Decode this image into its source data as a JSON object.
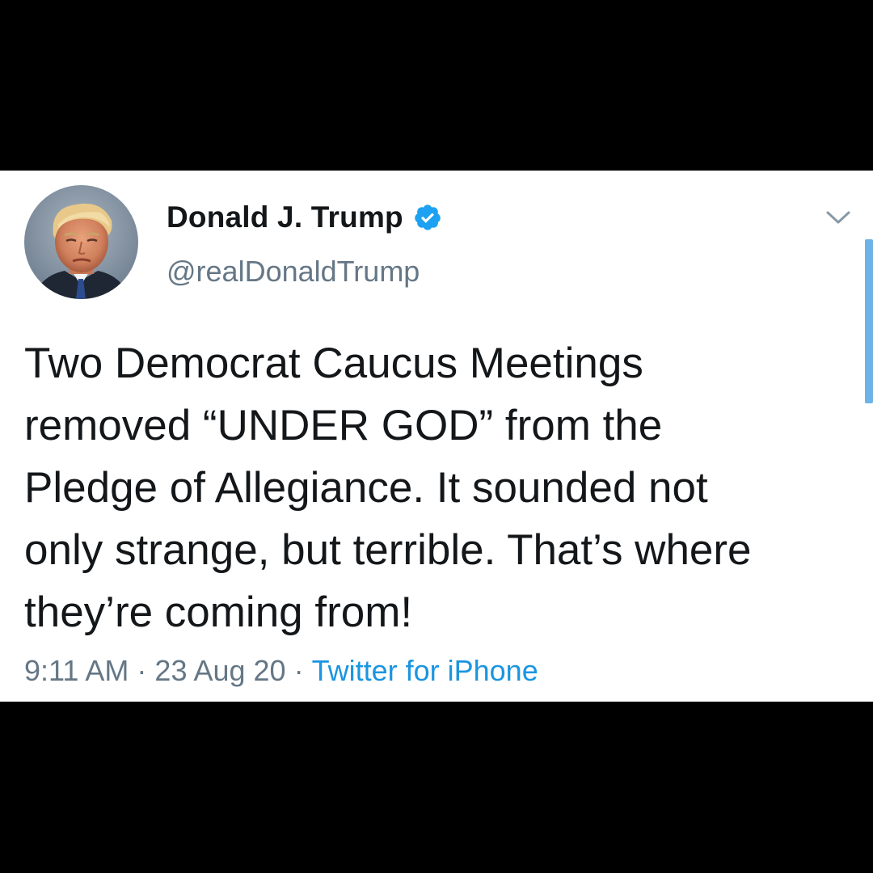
{
  "tweet": {
    "author": {
      "display_name": "Donald J. Trump",
      "handle": "@realDonaldTrump",
      "verified": true,
      "verified_icon": "verified-badge-icon",
      "avatar": "profile-photo"
    },
    "text_lines": [
      "Two Democrat Caucus Meetings",
      "removed “UNDER GOD” from the",
      "Pledge of Allegiance. It sounded not",
      "only strange, but terrible. That’s where",
      "they’re coming from!"
    ],
    "time": "9:11 AM",
    "date": "23 Aug 20",
    "separator": "·",
    "source": "Twitter for iPhone",
    "menu_icon": "chevron-down-icon"
  },
  "colors": {
    "background": "#000000",
    "card": "#ffffff",
    "text": "#14171a",
    "secondary": "#657786",
    "link": "#1b95e0",
    "verified": "#1da1f2",
    "scrollbar": "#6db3e8"
  }
}
